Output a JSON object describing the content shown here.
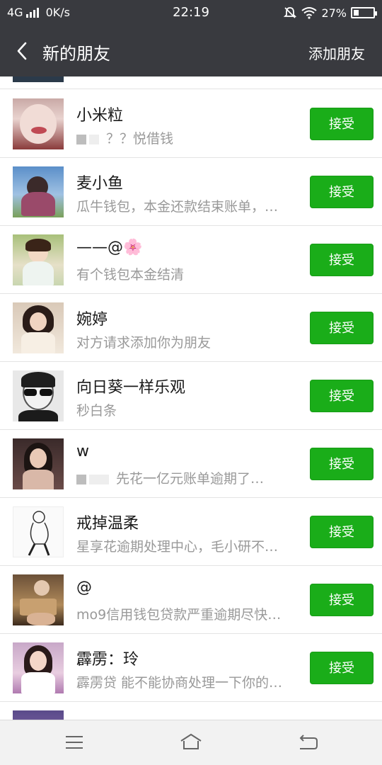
{
  "status": {
    "network": "4G",
    "speed": "0K/s",
    "time": "22:19",
    "battery": "27%",
    "battery_level": 0.27
  },
  "nav": {
    "title": "新的朋友",
    "action": "添加朋友"
  },
  "accept_label": "接受",
  "rows": [
    {
      "name": "小米粒",
      "message": "？？悦借钱"
    },
    {
      "name": "麦小鱼",
      "message": "瓜牛钱包，本金还款结束账单，…"
    },
    {
      "name": "——@🌸",
      "message": "有个钱包本金结清"
    },
    {
      "name": "婉婷",
      "message": "对方请求添加你为朋友"
    },
    {
      "name": "向日葵一样乐观",
      "message": "秒白条"
    },
    {
      "name": "w",
      "message": "先花一亿元账单逾期了…"
    },
    {
      "name": "戒掉温柔",
      "message": "星享花逾期处理中心，毛小研不…"
    },
    {
      "name": "@",
      "message": "mo9信用钱包贷款严重逾期尽快…"
    },
    {
      "name": "霹雳：玲",
      "message": "霹雳贷 能不能协商处理一下你的…"
    }
  ]
}
